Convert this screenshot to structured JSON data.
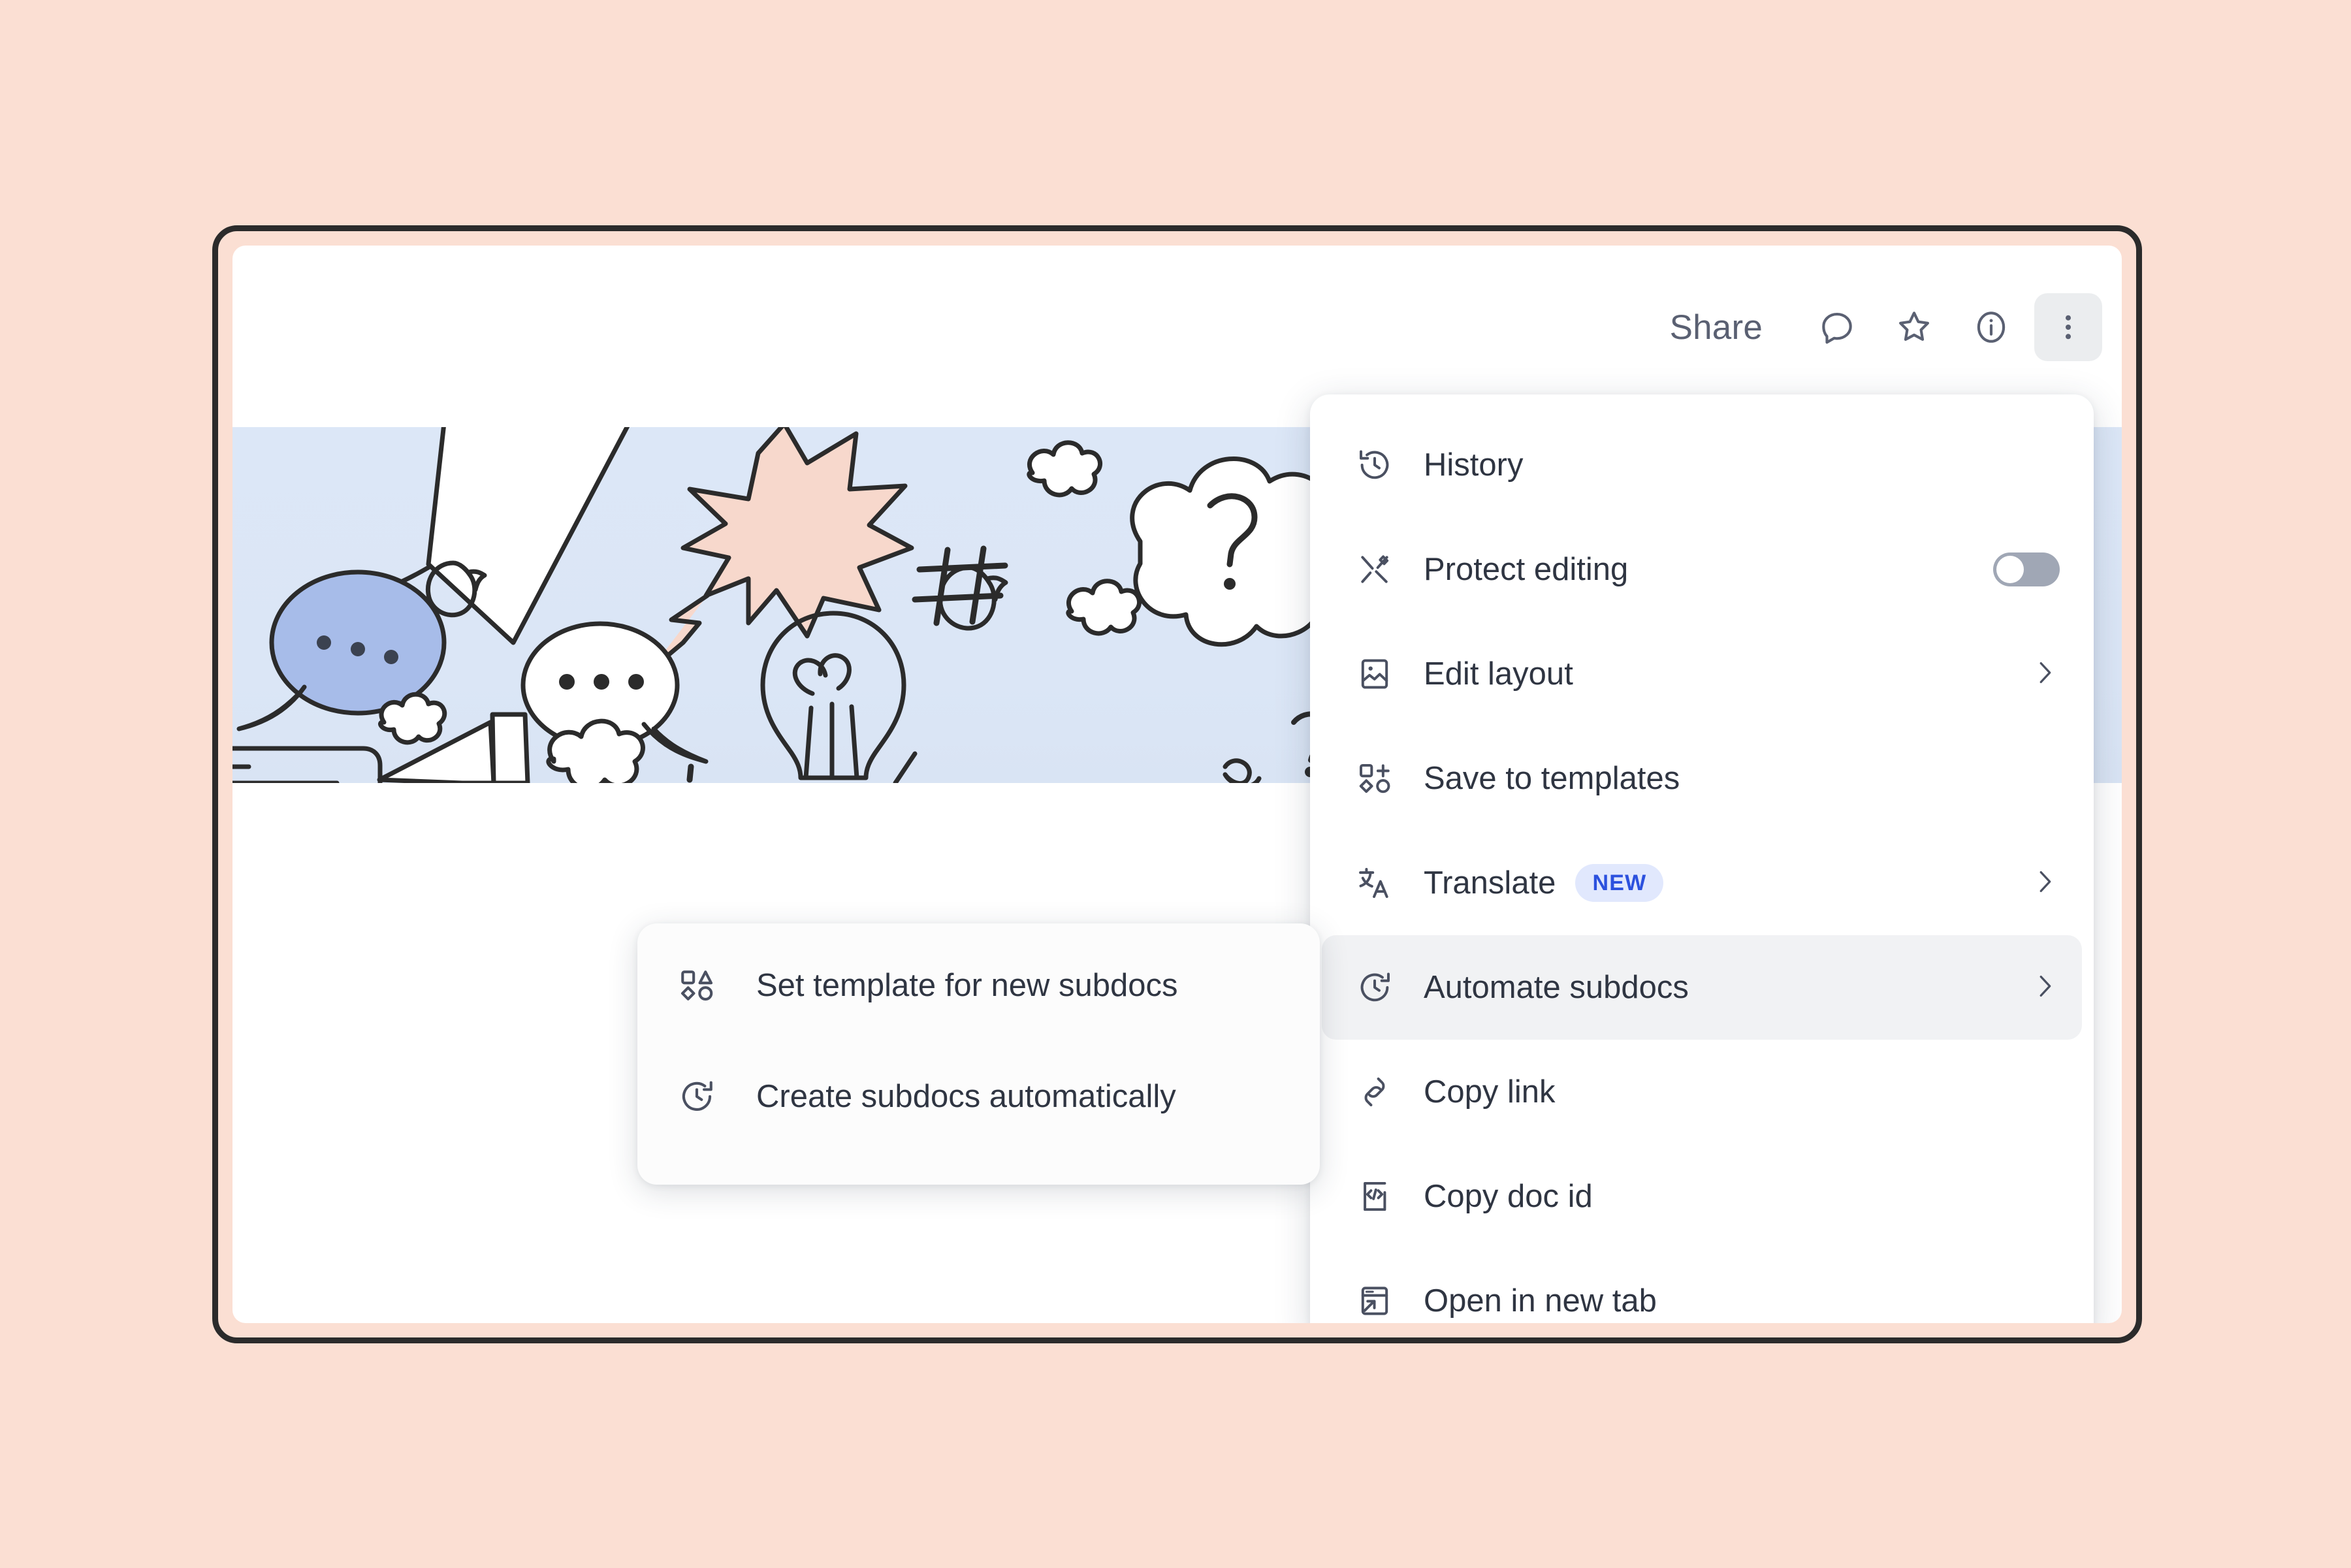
{
  "page": {
    "background_color": "#FBDFD3",
    "window_border_color": "#2B2B2B"
  },
  "toolbar": {
    "share_label": "Share",
    "icons": [
      {
        "name": "comment-icon"
      },
      {
        "name": "star-icon"
      },
      {
        "name": "info-icon"
      },
      {
        "name": "more-options-icon"
      }
    ]
  },
  "illustration": {
    "band_color": "#DCE7F7",
    "accent_blue": "#94AEE4",
    "accent_peach": "#F7D8CC",
    "ink_color": "#2B2B2B"
  },
  "dropdown": {
    "highlight_color": "#F1F2F4",
    "items": [
      {
        "label": "History",
        "icon": "history-icon",
        "trailing": "none"
      },
      {
        "label": "Protect editing",
        "icon": "protect-editing-icon",
        "trailing": "toggle",
        "toggle_on": false
      },
      {
        "label": "Edit layout",
        "icon": "edit-layout-icon",
        "trailing": "chevron"
      },
      {
        "label": "Save to templates",
        "icon": "save-to-templates-icon",
        "trailing": "none"
      },
      {
        "label": "Translate",
        "icon": "translate-icon",
        "trailing": "chevron",
        "badge": "NEW"
      },
      {
        "label": "Automate subdocs",
        "icon": "automate-subdocs-icon",
        "trailing": "chevron",
        "highlighted": true
      },
      {
        "label": "Copy link",
        "icon": "link-icon",
        "trailing": "none"
      },
      {
        "label": "Copy doc id",
        "icon": "code-doc-icon",
        "trailing": "none"
      },
      {
        "label": "Open in new tab",
        "icon": "open-in-new-tab-icon",
        "trailing": "none"
      }
    ]
  },
  "submenu": {
    "items": [
      {
        "label": "Set template for new subdocs",
        "icon": "shapes-icon"
      },
      {
        "label": "Create subdocs automatically",
        "icon": "clock-arrow-icon"
      }
    ]
  },
  "badge": {
    "new_bg": "#E1E8FD",
    "new_text": "#2C51DE"
  }
}
